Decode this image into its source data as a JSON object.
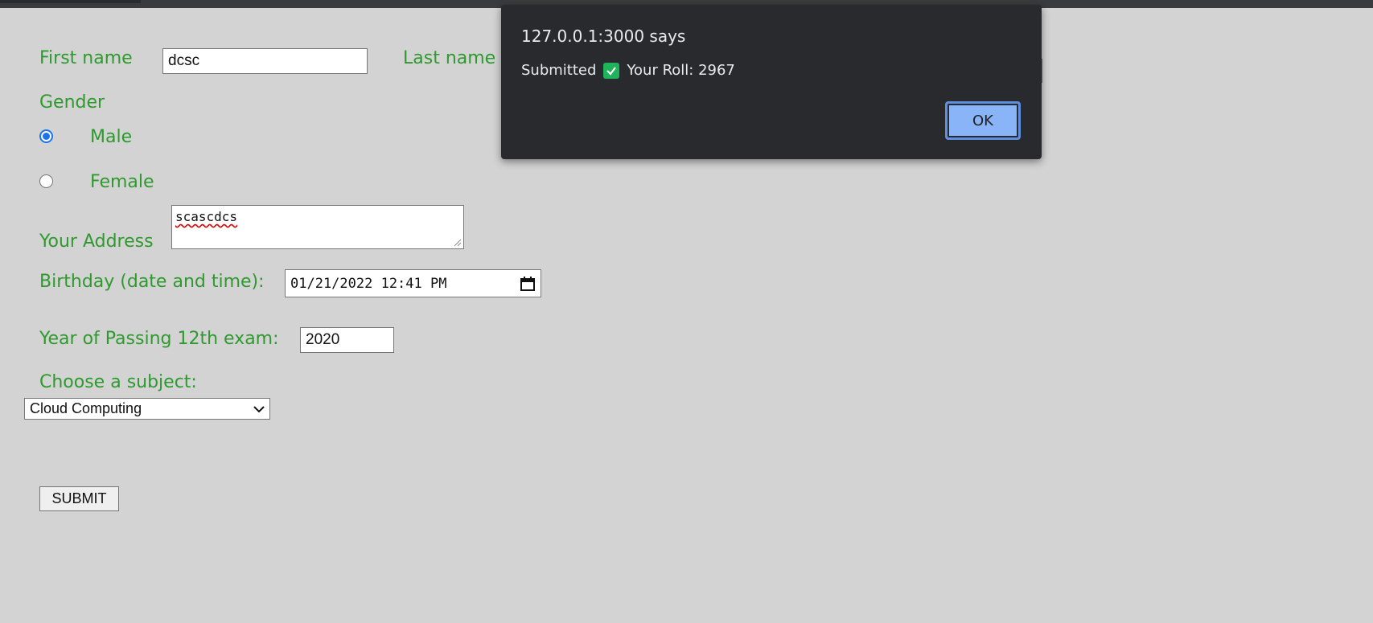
{
  "form": {
    "first_name_label": "First name",
    "first_name_value": "dcsc",
    "last_name_label": "Last name",
    "gender_label": "Gender",
    "gender_options": [
      {
        "label": "Male",
        "checked": true
      },
      {
        "label": "Female",
        "checked": false
      }
    ],
    "address_label": "Your Address",
    "address_value": "scascdcs",
    "birthday_label": "Birthday (date and time):",
    "birthday_value": "01/21/2022 12:41 PM",
    "year_label": "Year of Passing 12th exam:",
    "year_value": "2020",
    "subject_label": "Choose a subject:",
    "subject_selected": "Cloud Computing",
    "submit_label": "SUBMIT",
    "label_color": "#2e9a2e"
  },
  "dialog": {
    "title": "127.0.0.1:3000 says",
    "message_prefix": "Submitted",
    "message_icon": "white-check-mark-icon",
    "message_suffix": "Your Roll: 2967",
    "ok_label": "OK",
    "background": "#292a2d",
    "button_color": "#8ab4f8"
  }
}
